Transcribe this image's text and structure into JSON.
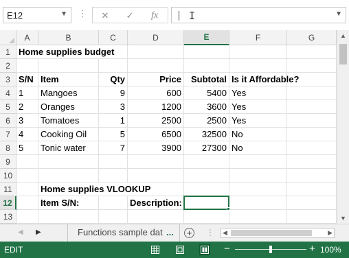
{
  "formula_bar": {
    "name_box": "E12",
    "cancel_symbol": "✕",
    "enter_symbol": "✓",
    "function_symbol": "fx",
    "formula_value": ""
  },
  "columns": [
    "A",
    "B",
    "C",
    "D",
    "E",
    "F",
    "G"
  ],
  "active_column": "E",
  "rows": [
    "1",
    "2",
    "3",
    "4",
    "5",
    "6",
    "7",
    "8",
    "9",
    "10",
    "11",
    "12",
    "13"
  ],
  "active_row": "12",
  "sheet": {
    "title": "Home supplies budget",
    "headers": [
      "S/N",
      "Item",
      "Qty",
      "Price",
      "Subtotal",
      "Is it Affordable?"
    ],
    "data": [
      [
        "1",
        "Mangoes",
        "9",
        "600",
        "5400",
        "Yes"
      ],
      [
        "2",
        "Oranges",
        "3",
        "1200",
        "3600",
        "Yes"
      ],
      [
        "3",
        "Tomatoes",
        "1",
        "2500",
        "2500",
        "Yes"
      ],
      [
        "4",
        "Cooking Oil",
        "5",
        "6500",
        "32500",
        "No"
      ],
      [
        "5",
        "Tonic water",
        "7",
        "3900",
        "27300",
        "No"
      ]
    ],
    "vlookup_title": "Home supplies VLOOKUP",
    "item_sn_label": "Item S/N:",
    "description_label": "Description:"
  },
  "tabs": {
    "sheet_name": "Functions sample dat",
    "more": "...",
    "add_symbol": "+"
  },
  "status": {
    "mode": "EDIT",
    "zoom_minus": "−",
    "zoom_plus": "+",
    "zoom_level": "100%"
  },
  "colors": {
    "accent": "#217346",
    "status_bar": "#217346"
  }
}
